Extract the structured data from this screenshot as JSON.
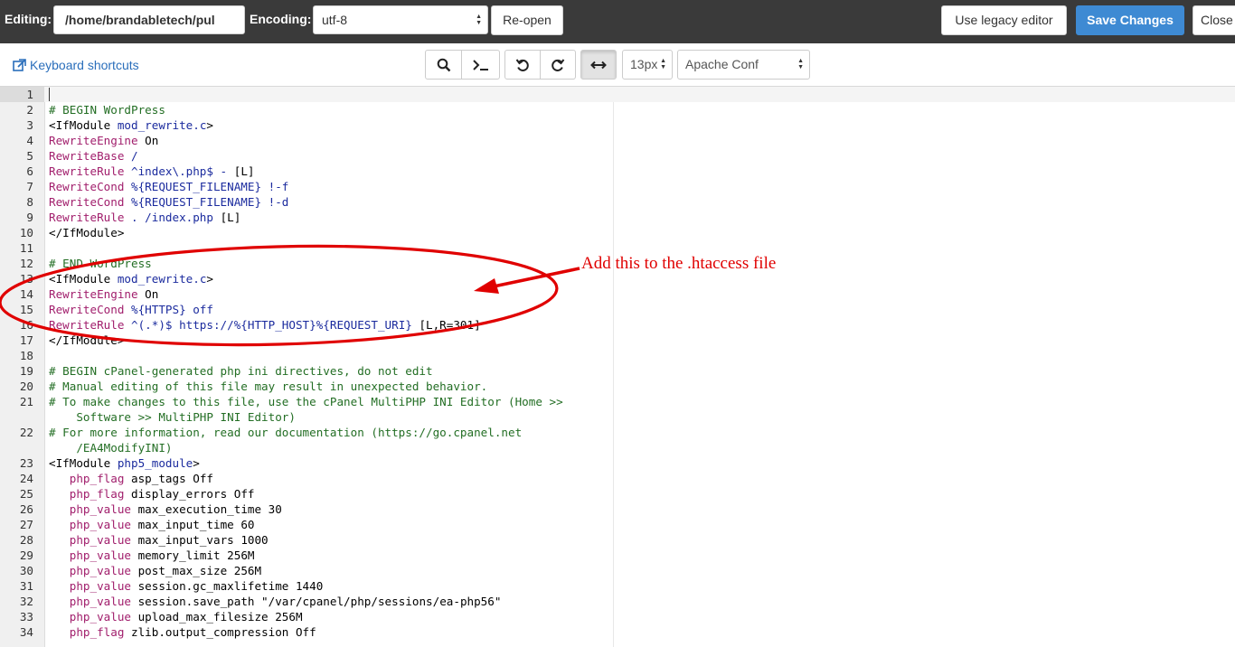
{
  "topbar": {
    "editing_label": "Editing:",
    "path_value": "/home/brandabletech/pul",
    "encoding_label": "Encoding:",
    "encoding_value": "utf-8",
    "reopen_label": "Re-open",
    "legacy_label": "Use legacy editor",
    "save_label": "Save Changes",
    "close_label": "Close"
  },
  "toolbar": {
    "keyboard_shortcuts": "Keyboard shortcuts",
    "font_size": "13px",
    "mode": "Apache Conf",
    "icons": [
      "search-icon",
      "terminal-icon",
      "undo-icon",
      "redo-icon",
      "wrap-icon"
    ]
  },
  "annotation": {
    "text": "Add this to the .htaccess file",
    "color": "#e00000"
  },
  "editor": {
    "lines": [
      {
        "num": "1",
        "tokens": []
      },
      {
        "num": "2",
        "tokens": [
          {
            "t": "# BEGIN WordPress",
            "c": "k-c"
          }
        ]
      },
      {
        "num": "3",
        "tokens": [
          {
            "t": "<IfModule ",
            "c": "k-p"
          },
          {
            "t": "mod_rewrite.c",
            "c": "k-t"
          },
          {
            "t": ">",
            "c": "k-p"
          }
        ]
      },
      {
        "num": "4",
        "tokens": [
          {
            "t": "RewriteEngine",
            "c": "k-d"
          },
          {
            "t": " On",
            "c": "k-p"
          }
        ]
      },
      {
        "num": "5",
        "tokens": [
          {
            "t": "RewriteBase",
            "c": "k-d"
          },
          {
            "t": " /",
            "c": "k-s"
          }
        ]
      },
      {
        "num": "6",
        "tokens": [
          {
            "t": "RewriteRule",
            "c": "k-d"
          },
          {
            "t": " ^index\\.php$ - ",
            "c": "k-s"
          },
          {
            "t": "[L]",
            "c": "k-p"
          }
        ]
      },
      {
        "num": "7",
        "tokens": [
          {
            "t": "RewriteCond",
            "c": "k-d"
          },
          {
            "t": " %{REQUEST_FILENAME} !-f",
            "c": "k-s"
          }
        ]
      },
      {
        "num": "8",
        "tokens": [
          {
            "t": "RewriteCond",
            "c": "k-d"
          },
          {
            "t": " %{REQUEST_FILENAME} !-d",
            "c": "k-s"
          }
        ]
      },
      {
        "num": "9",
        "tokens": [
          {
            "t": "RewriteRule",
            "c": "k-d"
          },
          {
            "t": " . /index.php ",
            "c": "k-s"
          },
          {
            "t": "[L]",
            "c": "k-p"
          }
        ]
      },
      {
        "num": "10",
        "tokens": [
          {
            "t": "</IfModule>",
            "c": "k-p"
          }
        ]
      },
      {
        "num": "11",
        "tokens": []
      },
      {
        "num": "12",
        "tokens": [
          {
            "t": "# END WordPress",
            "c": "k-c"
          }
        ]
      },
      {
        "num": "13",
        "tokens": [
          {
            "t": "<IfModule ",
            "c": "k-p"
          },
          {
            "t": "mod_rewrite.c",
            "c": "k-t"
          },
          {
            "t": ">",
            "c": "k-p"
          }
        ]
      },
      {
        "num": "14",
        "tokens": [
          {
            "t": "RewriteEngine",
            "c": "k-d"
          },
          {
            "t": " On",
            "c": "k-p"
          }
        ]
      },
      {
        "num": "15",
        "tokens": [
          {
            "t": "RewriteCond",
            "c": "k-d"
          },
          {
            "t": " %{HTTPS} off",
            "c": "k-s"
          }
        ]
      },
      {
        "num": "16",
        "tokens": [
          {
            "t": "RewriteRule",
            "c": "k-d"
          },
          {
            "t": " ^(.*)$ https://%{HTTP_HOST}%{REQUEST_URI} ",
            "c": "k-s"
          },
          {
            "t": "[L,R=301]",
            "c": "k-p"
          }
        ]
      },
      {
        "num": "17",
        "tokens": [
          {
            "t": "</IfModule>",
            "c": "k-p"
          }
        ]
      },
      {
        "num": "18",
        "tokens": []
      },
      {
        "num": "19",
        "tokens": [
          {
            "t": "# BEGIN cPanel-generated php ini directives, do not edit",
            "c": "k-c"
          }
        ]
      },
      {
        "num": "20",
        "tokens": [
          {
            "t": "# Manual editing of this file may result in unexpected behavior.",
            "c": "k-c"
          }
        ]
      },
      {
        "num": "21",
        "tokens": [
          {
            "t": "# To make changes to this file, use the cPanel MultiPHP INI Editor (Home >>",
            "c": "k-c"
          }
        ]
      },
      {
        "num": "",
        "tokens": [
          {
            "t": "    Software >> MultiPHP INI Editor)",
            "c": "k-c"
          }
        ]
      },
      {
        "num": "22",
        "tokens": [
          {
            "t": "# For more information, read our documentation (https://go.cpanel.net",
            "c": "k-c"
          }
        ]
      },
      {
        "num": "",
        "tokens": [
          {
            "t": "    /EA4ModifyINI)",
            "c": "k-c"
          }
        ]
      },
      {
        "num": "23",
        "tokens": [
          {
            "t": "<IfModule ",
            "c": "k-p"
          },
          {
            "t": "php5_module",
            "c": "k-t"
          },
          {
            "t": ">",
            "c": "k-p"
          }
        ]
      },
      {
        "num": "24",
        "tokens": [
          {
            "t": "   ",
            "c": "k-p"
          },
          {
            "t": "php_flag",
            "c": "k-d"
          },
          {
            "t": " asp_tags Off",
            "c": "k-p"
          }
        ]
      },
      {
        "num": "25",
        "tokens": [
          {
            "t": "   ",
            "c": "k-p"
          },
          {
            "t": "php_flag",
            "c": "k-d"
          },
          {
            "t": " display_errors Off",
            "c": "k-p"
          }
        ]
      },
      {
        "num": "26",
        "tokens": [
          {
            "t": "   ",
            "c": "k-p"
          },
          {
            "t": "php_value",
            "c": "k-d"
          },
          {
            "t": " max_execution_time 30",
            "c": "k-p"
          }
        ]
      },
      {
        "num": "27",
        "tokens": [
          {
            "t": "   ",
            "c": "k-p"
          },
          {
            "t": "php_value",
            "c": "k-d"
          },
          {
            "t": " max_input_time 60",
            "c": "k-p"
          }
        ]
      },
      {
        "num": "28",
        "tokens": [
          {
            "t": "   ",
            "c": "k-p"
          },
          {
            "t": "php_value",
            "c": "k-d"
          },
          {
            "t": " max_input_vars 1000",
            "c": "k-p"
          }
        ]
      },
      {
        "num": "29",
        "tokens": [
          {
            "t": "   ",
            "c": "k-p"
          },
          {
            "t": "php_value",
            "c": "k-d"
          },
          {
            "t": " memory_limit 256M",
            "c": "k-p"
          }
        ]
      },
      {
        "num": "30",
        "tokens": [
          {
            "t": "   ",
            "c": "k-p"
          },
          {
            "t": "php_value",
            "c": "k-d"
          },
          {
            "t": " post_max_size 256M",
            "c": "k-p"
          }
        ]
      },
      {
        "num": "31",
        "tokens": [
          {
            "t": "   ",
            "c": "k-p"
          },
          {
            "t": "php_value",
            "c": "k-d"
          },
          {
            "t": " session.gc_maxlifetime 1440",
            "c": "k-p"
          }
        ]
      },
      {
        "num": "32",
        "tokens": [
          {
            "t": "   ",
            "c": "k-p"
          },
          {
            "t": "php_value",
            "c": "k-d"
          },
          {
            "t": " session.save_path \"/var/cpanel/php/sessions/ea-php56\"",
            "c": "k-p"
          }
        ]
      },
      {
        "num": "33",
        "tokens": [
          {
            "t": "   ",
            "c": "k-p"
          },
          {
            "t": "php_value",
            "c": "k-d"
          },
          {
            "t": " upload_max_filesize 256M",
            "c": "k-p"
          }
        ]
      },
      {
        "num": "34",
        "tokens": [
          {
            "t": "   ",
            "c": "k-p"
          },
          {
            "t": "php_flag",
            "c": "k-d"
          },
          {
            "t": " zlib.output_compression Off",
            "c": "k-p"
          }
        ]
      }
    ]
  }
}
